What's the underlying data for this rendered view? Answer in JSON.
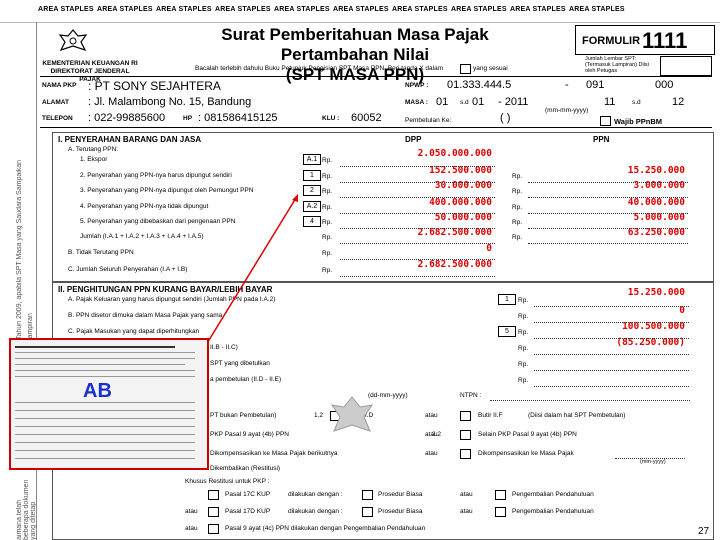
{
  "header_strip": [
    "AREA STAPLES",
    "AREA STAPLES",
    "AREA STAPLES",
    "AREA STAPLES",
    "AREA STAPLES",
    "AREA STAPLES",
    "AREA STAPLES",
    "AREA STAPLES",
    "AREA STAPLES",
    "AREA STAPLES"
  ],
  "agency": {
    "line1": "KEMENTERIAN KEUANGAN RI",
    "line2": "DIREKTORAT JENDERAL PAJAK"
  },
  "title": {
    "line1": "Surat Pemberitahuan Masa Pajak Pertambahan Nilai",
    "line2": "(SPT MASA PPN)"
  },
  "note": "Bacalah terlebih dahulu Buku Petunjuk Pengisian SPT Masa PPN. Beri tanda X dalam",
  "note2": "yang sesuai",
  "formulir": {
    "label": "FORMULIR",
    "number": "1111",
    "lampiran": "Jumlah Lembar SPT: (Termasuk Lampiran) Diisi oleh Petugas"
  },
  "petugas": {
    "a": "091",
    "b": "000",
    "c": "11",
    "d": "12"
  },
  "fields": {
    "nama_label": "NAMA PKP",
    "nama": ": PT SONY SEJAHTERA",
    "alamat_label": "ALAMAT",
    "alamat": ": Jl. Malambong No. 15, Bandung",
    "telepon_label": "TELEPON",
    "telepon": ": 022-99885600",
    "hp_label": "HP",
    "hp": ": 081586415125",
    "klu_label": "KLU :",
    "klu": "60052",
    "npwp_label": "NPWP :",
    "npwp": "01.333.444.5",
    "npwp2": "-",
    "masa_label": "MASA :",
    "masa_from": "01",
    "sd": "s.d",
    "masa_to": "01",
    "tahun": "- 2011",
    "fmt": "(mm-mm-yyyy)",
    "pembetulan": "Pembetulan Ke:",
    "pembetulan_paren": "(           )",
    "wajib": "Wajib PPnBM"
  },
  "side_text": {
    "a": "Tahun 2009, apabila SPT Masa yang Saudara Sampaikan",
    "b": "lampiran"
  },
  "section1": {
    "title": "I.  PENYERAHAN BARANG DAN JASA",
    "dpp": "DPP",
    "ppn": "PPN",
    "a": "A. Terutang PPN:"
  },
  "rows1": [
    {
      "label": "1. Ekspor",
      "box": "A.1",
      "rp": "Rp.",
      "dpp": "2.050.000.000",
      "ppn": ""
    },
    {
      "label": "2. Penyerahan yang PPN-nya harus dipungut sendiri",
      "box": "1",
      "rp": "Rp.",
      "dpp": "152.500.000",
      "ppn": "15.250.000"
    },
    {
      "label": "3. Penyerahan yang PPN-nya dipungut oleh Pemungut PPN",
      "box": "2",
      "rp": "Rp.",
      "dpp": "30.000.000",
      "ppn": "3.000.000"
    },
    {
      "label": "4. Penyerahan yang PPN-nya tidak dipungut",
      "box": "A.2",
      "rp": "Rp.",
      "dpp": "400.000.000",
      "ppn": "40.000.000"
    },
    {
      "label": "5. Penyerahan yang dibebaskan dari pengenaan PPN",
      "box": "4",
      "rp": "Rp.",
      "dpp": "50.000.000",
      "ppn": "5.000.000"
    },
    {
      "label": "Jumlah (I.A.1 + I.A.2 + I.A.3 + I.A.4 + I.A.5)",
      "box": "",
      "rp": "Rp.",
      "dpp": "2.682.500.000",
      "ppn": "63.250.000"
    },
    {
      "label": "B. Tidak Terutang PPN",
      "box": "",
      "rp": "Rp.",
      "dpp": "0",
      "ppn": ""
    },
    {
      "label": "C. Jumlah Seluruh Penyerahan (I.A + I.B)",
      "box": "",
      "rp": "Rp.",
      "dpp": "2.682.500.000",
      "ppn": ""
    }
  ],
  "section2": {
    "title": "II. PENGHITUNGAN PPN KURANG BAYAR/LEBIH BAYAR"
  },
  "rows2": [
    {
      "label": "A. Pajak Keluaran yang harus dipungut sendiri (Jumlah PPN pada I.A.2)",
      "box": "1",
      "rp": "Rp.",
      "val": "15.250.000"
    },
    {
      "label": "B. PPN disetor dimuka dalam Masa Pajak yang sama",
      "box": "",
      "rp": "Rp.",
      "val": "0"
    },
    {
      "label": "C. Pajak Masukan yang dapat diperhitungkan",
      "box": "5",
      "rp": "Rp.",
      "val": "100.500.000"
    },
    {
      "label": "II.B - II.C)",
      "box": "",
      "rp": "Rp.",
      "val": "(85.250.000)"
    },
    {
      "label": "SPT yang dibetulkan",
      "box": "",
      "rp": "Rp.",
      "val": ""
    },
    {
      "label": "a pembetulan (II.D - II.E)",
      "box": "",
      "rp": "Rp.",
      "val": ""
    }
  ],
  "dd": "(dd-mm-yyyy)",
  "ntpn": "NTPN :",
  "opt": {
    "pt": "PT bukan Pembetulan)",
    "n12": "1.2",
    "butir_d": "Butir II.D",
    "atau": "atau",
    "butir_f": "Butir II.F",
    "diisi": "(Diisi dalam hal SPT Pembetulan)",
    "pkp": "PKP Pasal 9 ayat (4b) PPN",
    "n22": "2.2",
    "selain": "Selain PKP Pasal 9 ayat (4b) PPN",
    "dikomp1": "Dikompensasikan ke Masa Pajak berikutnya",
    "dikomp2": "Dikompensasikan ke Masa Pajak",
    "mmyyyy": "(mm-yyyy)",
    "n32": "3.2",
    "dikemb": "Dikembalikan (Restitusi)",
    "khusus": "Khusus Restitusi untuk PKP :",
    "p17c": "Pasal 17C KUP",
    "p17d": "Pasal 17D KUP",
    "dilakukan": "dilakukan dengan :",
    "prosedur": "Prosedur Biasa",
    "pengembalian": "Pengembalian Pendahuluan",
    "pasal9": "Pasal 9 ayat (4c) PPN dilakukan dengan Pengembalian Pendahuluan"
  },
  "left_side": "aimana telah beberapa dokumen yang ditetap",
  "thumbnail": {
    "label": "AB"
  },
  "page_number": "27",
  "colors": {
    "accent": "#dd0000",
    "thumb_border": "#cc0000",
    "ab": "#1a2fd0"
  }
}
